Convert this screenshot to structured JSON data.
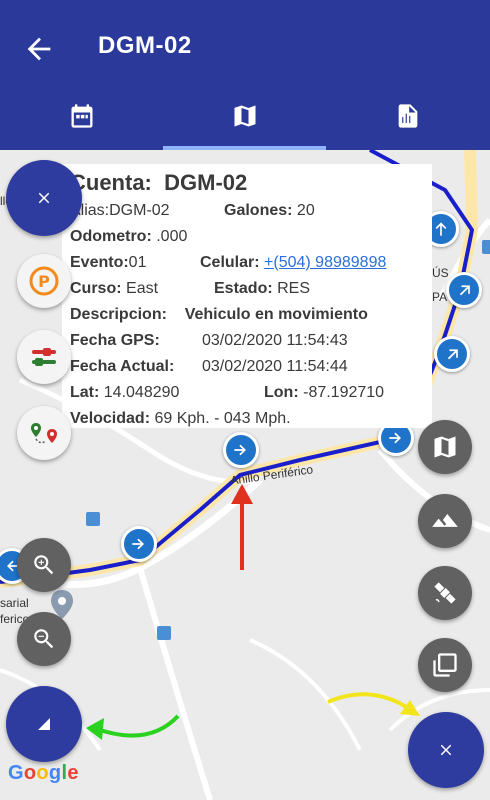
{
  "appbar": {
    "title": "DGM-02"
  },
  "tabs": [
    {
      "icon": "calendar-icon",
      "active": false
    },
    {
      "icon": "map-icon",
      "active": true
    },
    {
      "icon": "report-icon",
      "active": false
    }
  ],
  "info": {
    "cuenta_label": "Cuenta:",
    "cuenta_value": "DGM-02",
    "alias_label": "Alias:",
    "alias_value": "DGM-02",
    "galones_label": "Galones:",
    "galones_value": "20",
    "odometro_label": "Odometro:",
    "odometro_value": ".000",
    "evento_label": "Evento:",
    "evento_value": "01",
    "celular_label": "Celular:",
    "celular_value": "+(504) 98989898",
    "curso_label": "Curso:",
    "curso_value": "East",
    "estado_label": "Estado:",
    "estado_value": "RES",
    "descripcion_label": "Descripcion:",
    "descripcion_value": "Vehiculo en movimiento",
    "fecha_gps_label": "Fecha GPS:",
    "fecha_gps_value": "03/02/2020 11:54:43",
    "fecha_actual_label": "Fecha Actual:",
    "fecha_actual_value": "03/02/2020 11:54:44",
    "lat_label": "Lat:",
    "lat_value": "14.048290",
    "lon_label": "Lon:",
    "lon_value": "-87.192710",
    "velocidad_label": "Velocidad:",
    "velocidad_value": "69 Kph. - 043 Mph."
  },
  "map": {
    "road_label": "Anillo Periférico",
    "poi_left": "sarial",
    "poi_left2": "ferico",
    "poi_right": "ÚS",
    "poi_right2": "PA",
    "attribution": "Google",
    "route_color": "#1a1fcc"
  }
}
